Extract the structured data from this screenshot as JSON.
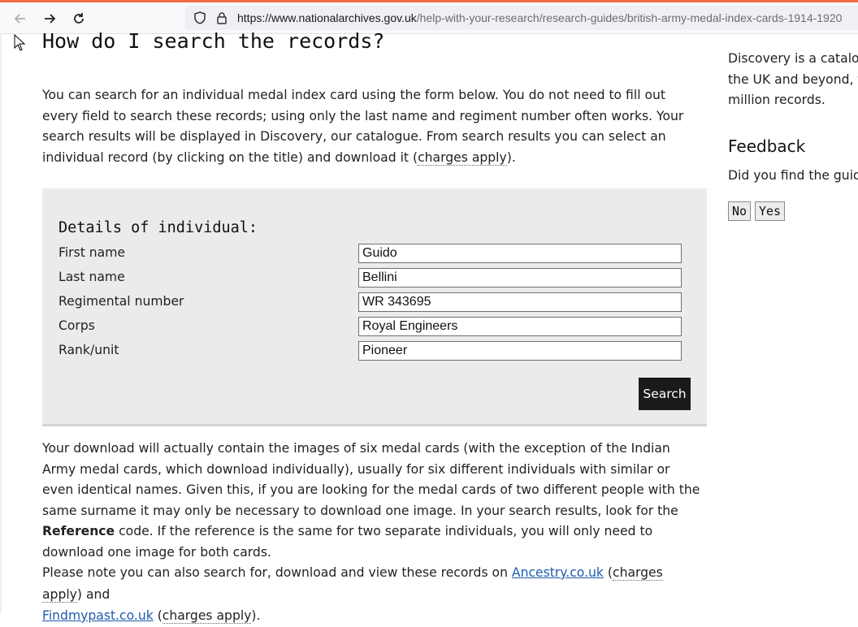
{
  "browser": {
    "url_domain": "https://www.nationalarchives.gov.uk",
    "url_path": "/help-with-your-research/research-guides/british-army-medal-index-cards-1914-1920"
  },
  "main": {
    "heading": "How do I search the records?",
    "intro": {
      "text1": "You can search for an individual medal index card using the form below. You do not need to fill out every field to search these records; using only the last name and regiment number often works. Your search results will be displayed in Discovery, our catalogue. From search results you can select an individual record (by clicking on the title) and download it (",
      "charges": "charges apply",
      "text2": ")."
    },
    "form": {
      "legend": "Details of individual:",
      "fields": [
        {
          "label": "First name",
          "value": "Guido"
        },
        {
          "label": "Last name",
          "value": "Bellini"
        },
        {
          "label": "Regimental number",
          "value": "WR 343695"
        },
        {
          "label": "Corps",
          "value": "Royal Engineers"
        },
        {
          "label": "Rank/unit",
          "value": "Pioneer"
        }
      ],
      "search_label": "Search"
    },
    "download_para": {
      "text1": "Your download will actually contain the images of six medal cards (with the exception of the Indian Army medal cards, which download individually), usually for six different individuals with similar or even identical names. Given this, if you are looking for the medal cards of two different people with the same surname it may only be necessary to download one image. In your search results, look for the ",
      "bold": "Reference",
      "text2": " code. If the reference is the same for two separate individuals, you will only need to download one image for both cards."
    },
    "note_para": {
      "text1": "Please note you can also search for, download and view these records on ",
      "link1": "Ancestry.co.uk",
      "text2": " (",
      "charges1": "charges apply",
      "text3": ") and ",
      "link2": "Findmypast.co.uk",
      "text4": " (",
      "charges2": "charges apply",
      "text5": ")."
    }
  },
  "sidebar": {
    "line1": "Discovery is a catalogu",
    "line2": "the UK and beyond, fr",
    "line3": "million records.",
    "feedback_title": "Feedback",
    "feedback_question": "Did you find the guida",
    "no_label": "No",
    "yes_label": "Yes"
  },
  "colors": {
    "accent_orange": "#f06b45",
    "link": "#1d5bae",
    "button_dark": "#1a1a1a",
    "form_bg": "#ebebeb"
  }
}
